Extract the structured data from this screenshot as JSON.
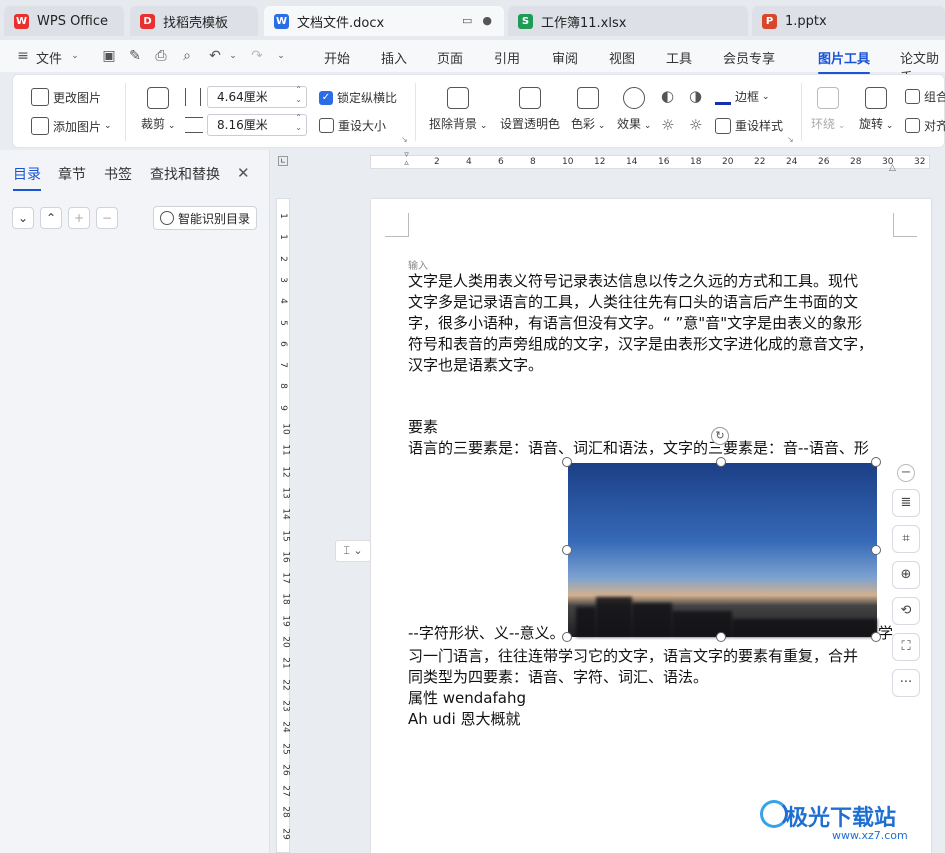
{
  "tabs": [
    {
      "label": "WPS Office",
      "icon": "wps-logo-icon",
      "color": "#e8312f"
    },
    {
      "label": "找稻壳模板",
      "icon": "docer-icon",
      "color": "#e8312f"
    },
    {
      "label": "文档文件.docx",
      "icon": "W",
      "color": "#2b6de6"
    },
    {
      "label": "工作簿11.xlsx",
      "icon": "S",
      "color": "#1e9b56"
    },
    {
      "label": "1.pptx",
      "icon": "P",
      "color": "#d9472b"
    }
  ],
  "menu": {
    "file": "文件",
    "items": [
      "开始",
      "插入",
      "页面",
      "引用",
      "审阅",
      "视图",
      "工具",
      "会员专享",
      "图片工具",
      "论文助手"
    ],
    "active": "图片工具"
  },
  "ribbon": {
    "change_picture": "更改图片",
    "add_picture": "添加图片",
    "crop": "裁剪",
    "height_value": "4.64厘米",
    "width_value": "8.16厘米",
    "lock_ratio": "锁定纵横比",
    "reset_size": "重设大小",
    "remove_bg": "抠除背景",
    "set_transparent": "设置透明色",
    "color": "色彩",
    "effect": "效果",
    "border": "边框",
    "reset_style": "重设样式",
    "wrap": "环绕",
    "rotate": "旋转",
    "group": "组合",
    "align": "对齐"
  },
  "sidebar": {
    "tabs": [
      "目录",
      "章节",
      "书签",
      "查找和替换"
    ],
    "smart_toc": "智能识别目录"
  },
  "hruler_ticks": [
    "2",
    "4",
    "6",
    "8",
    "10",
    "12",
    "14",
    "16",
    "18",
    "20",
    "22",
    "24",
    "26",
    "28",
    "30",
    "32"
  ],
  "vruler_ticks": [
    "1",
    "1",
    "2",
    "3",
    "4",
    "5",
    "6",
    "7",
    "8",
    "9",
    "10",
    "11",
    "12",
    "13",
    "14",
    "15",
    "16",
    "17",
    "18",
    "19",
    "20",
    "21",
    "22",
    "23",
    "24",
    "25",
    "26",
    "27",
    "28",
    "29"
  ],
  "document": {
    "label": "输入",
    "para1": [
      "文字是人类用表义符号记录表达信息以传之久远的方式和工具。现代",
      "文字多是记录语言的工具，人类往往先有口头的语言后产生书面的文",
      "字，很多小语种，有语言但没有文字。“ ”意\"音\"文字是由表义的象形",
      "符号和表音的声旁组成的文字，汉字是由表形文字进化成的意音文字，",
      "汉字也是语素文字。"
    ],
    "heading": "要素",
    "line_before": "语言的三要素是：语音、词汇和语法，文字的三要素是：音--语音、形",
    "line_wrap_left": "--字符形状、义--意义。",
    "line_wrap_right": "学",
    "para2": [
      "习一门语言，往往连带学习它的文字，语言文字的要素有重复，合并",
      "同类型为四要素：语音、字符、词汇、语法。"
    ],
    "attr_line": "属性 wendafahg",
    "last_line": "Ah udi 恩大概就"
  },
  "watermark": "极光下载站",
  "watermark_url": "www.xz7.com"
}
